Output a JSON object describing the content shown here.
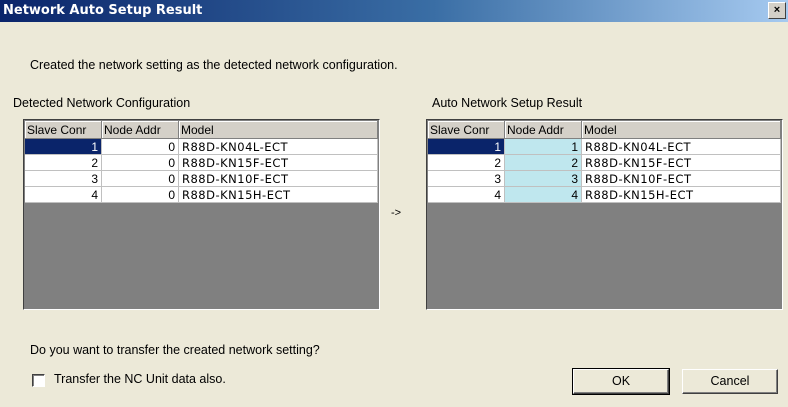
{
  "window": {
    "title": "Network Auto Setup Result",
    "close_glyph": "×",
    "close_icon": "close-icon"
  },
  "message": "Created the network setting as the detected network configuration.",
  "detected": {
    "label": "Detected Network Configuration",
    "columns": [
      "Slave Conr",
      "Node Addr",
      "Model"
    ],
    "rows": [
      {
        "slave": "1",
        "node": "0",
        "model": "R88D-KN04L-ECT"
      },
      {
        "slave": "2",
        "node": "0",
        "model": "R88D-KN15F-ECT"
      },
      {
        "slave": "3",
        "node": "0",
        "model": "R88D-KN10F-ECT"
      },
      {
        "slave": "4",
        "node": "0",
        "model": "R88D-KN15H-ECT"
      }
    ]
  },
  "arrow": "->",
  "result": {
    "label": "Auto Network Setup Result",
    "columns": [
      "Slave Conr",
      "Node Addr",
      "Model"
    ],
    "rows": [
      {
        "slave": "1",
        "node": "1",
        "model": "R88D-KN04L-ECT"
      },
      {
        "slave": "2",
        "node": "2",
        "model": "R88D-KN15F-ECT"
      },
      {
        "slave": "3",
        "node": "3",
        "model": "R88D-KN10F-ECT"
      },
      {
        "slave": "4",
        "node": "4",
        "model": "R88D-KN15H-ECT"
      }
    ]
  },
  "question": "Do you want to transfer the created network setting?",
  "checkbox": {
    "label": "Transfer the NC Unit data also.",
    "checked": false
  },
  "buttons": {
    "ok": "OK",
    "cancel": "Cancel"
  },
  "colors": {
    "selection": "#0a246a",
    "highlight": "#bfe7ee",
    "title_bar": "#0a246a"
  }
}
